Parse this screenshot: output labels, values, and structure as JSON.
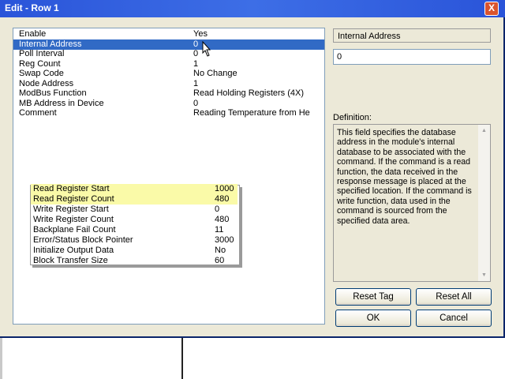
{
  "window": {
    "title": "Edit - Row 1",
    "close_label": "X"
  },
  "properties": [
    {
      "name": "Enable",
      "value": "Yes",
      "selected": false
    },
    {
      "name": "Internal Address",
      "value": "0",
      "selected": true
    },
    {
      "name": "Poll Interval",
      "value": "0",
      "selected": false
    },
    {
      "name": "Reg Count",
      "value": "1",
      "selected": false
    },
    {
      "name": "Swap Code",
      "value": "No Change",
      "selected": false
    },
    {
      "name": "Node Address",
      "value": "1",
      "selected": false
    },
    {
      "name": "ModBus Function",
      "value": "Read Holding Registers (4X)",
      "selected": false
    },
    {
      "name": "MB Address in Device",
      "value": "0",
      "selected": false
    },
    {
      "name": "Comment",
      "value": "Reading Temperature from He",
      "selected": false
    }
  ],
  "popup": [
    {
      "name": "Read Register Start",
      "value": "1000",
      "highlight": true
    },
    {
      "name": "Read Register Count",
      "value": "480",
      "highlight": true
    },
    {
      "name": "Write Register Start",
      "value": "0",
      "highlight": false
    },
    {
      "name": "Write Register Count",
      "value": "480",
      "highlight": false
    },
    {
      "name": "Backplane Fail Count",
      "value": "11",
      "highlight": false
    },
    {
      "name": "Error/Status Block Pointer",
      "value": "3000",
      "highlight": false
    },
    {
      "name": "Initialize Output Data",
      "value": "No",
      "highlight": false
    },
    {
      "name": "Block Transfer Size",
      "value": "60",
      "highlight": false
    }
  ],
  "editor": {
    "field_name": "Internal Address",
    "value": "0",
    "definition_label": "Definition:",
    "definition_text": "This field specifies the database address in the module's internal database to be associated with the command. If the command is a read function, the data received in the response message is placed at the specified location. If the command is write function, data used in the command is sourced from the specified data area."
  },
  "buttons": {
    "reset_tag": "Reset Tag",
    "reset_all": "Reset All",
    "ok": "OK",
    "cancel": "Cancel"
  }
}
